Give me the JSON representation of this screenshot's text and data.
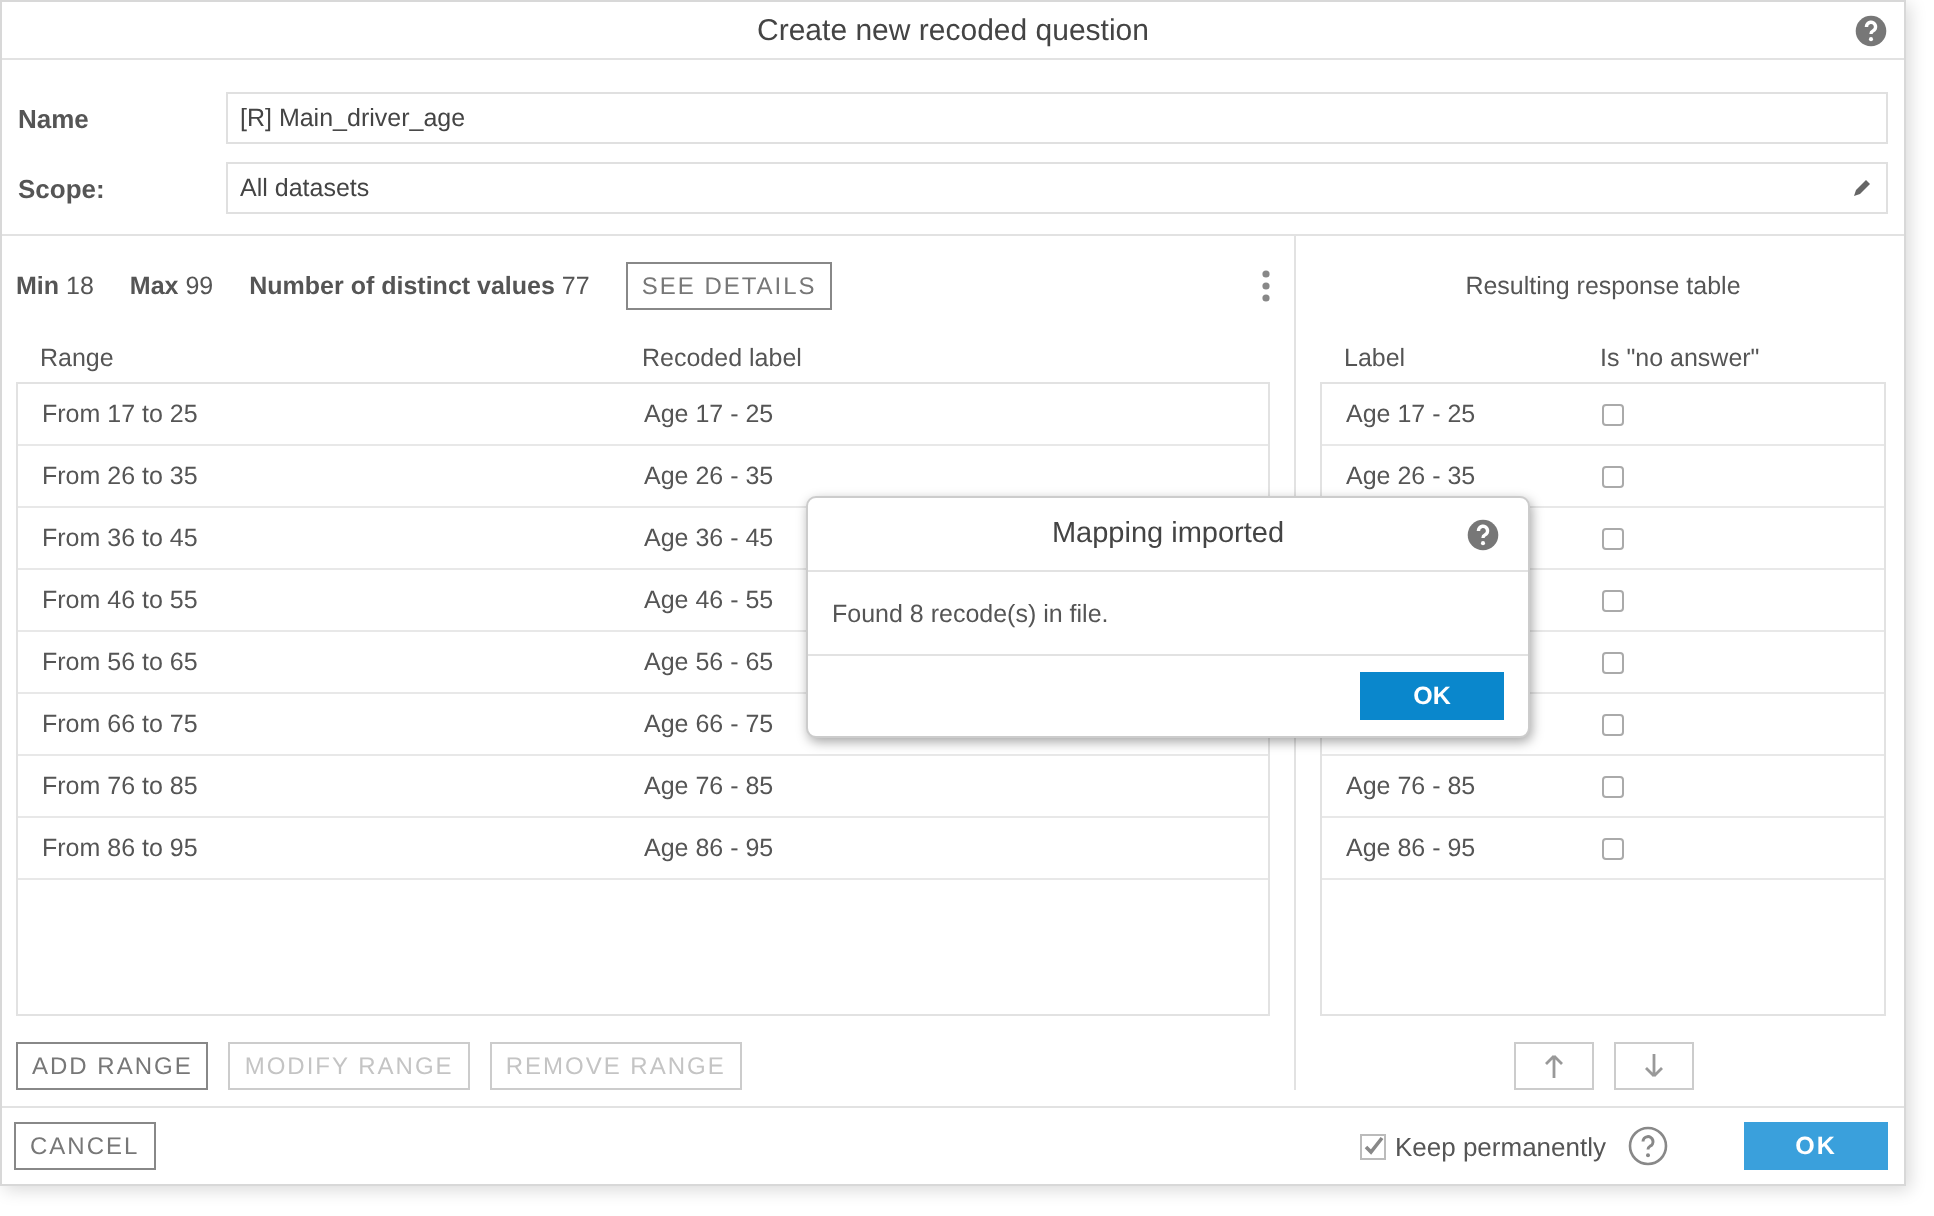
{
  "window": {
    "title": "Create new recoded question"
  },
  "form": {
    "name_label": "Name",
    "name_value": "[R] Main_driver_age",
    "scope_label": "Scope:",
    "scope_value": "All datasets"
  },
  "stats": [
    "**Min** 18",
    "**Max** 99",
    "**Number of distinct values** 77"
  ],
  "see_details": "SEE DETAILS",
  "recode_table": {
    "columns": [
      "Range",
      "Recoded label"
    ],
    "rows": [
      {
        "range": "From 17 to 25",
        "label": "Age 17 - 25"
      },
      {
        "range": "From 26 to 35",
        "label": "Age 26 - 35"
      },
      {
        "range": "From 36 to 45",
        "label": "Age 36 - 45"
      },
      {
        "range": "From 46 to 55",
        "label": "Age 46 - 55"
      },
      {
        "range": "From 56 to 65",
        "label": "Age 56 - 65"
      },
      {
        "range": "From 66 to 75",
        "label": "Age 66 - 75"
      },
      {
        "range": "From 76 to 85",
        "label": "Age 76 - 85"
      },
      {
        "range": "From 86 to 95",
        "label": "Age 86 - 95"
      }
    ]
  },
  "range_buttons": [
    {
      "label": "ADD RANGE",
      "disabled": false
    },
    {
      "label": "MODIFY RANGE",
      "disabled": true
    },
    {
      "label": "REMOVE RANGE",
      "disabled": true
    }
  ],
  "response_table": {
    "title": "Resulting response table",
    "columns": [
      "Label",
      "Is \"no answer\""
    ],
    "rows": [
      {
        "label": "Age 17 - 25",
        "no_answer": false
      },
      {
        "label": "Age 26 - 35",
        "no_answer": false
      },
      {
        "no_answer": false
      },
      {
        "no_answer": false
      },
      {
        "no_answer": false
      },
      {
        "no_answer": false
      },
      {
        "label": "Age 76 - 85",
        "no_answer": false
      },
      {
        "label": "Age 86 - 95",
        "no_answer": false
      }
    ]
  },
  "move_buttons": [
    {
      "kind": "up",
      "disabled": true
    },
    {
      "kind": "down",
      "disabled": true
    }
  ],
  "footer": {
    "cancel": "CANCEL",
    "keep": {
      "label": "Keep permanently",
      "checked": true
    },
    "ok": "OK"
  },
  "modal": {
    "title": "Mapping imported",
    "message": "Found 8 recode(s) in file.",
    "ok": "OK"
  }
}
